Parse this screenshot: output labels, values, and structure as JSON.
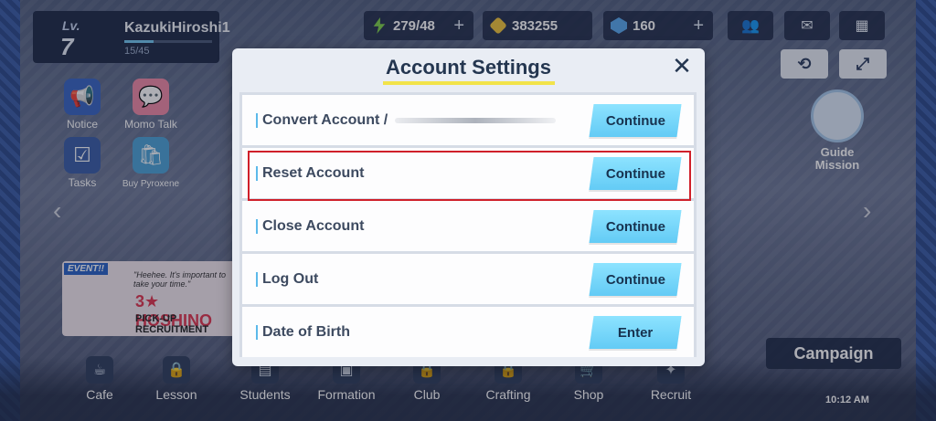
{
  "player": {
    "level_label": "Lv.",
    "level": "7",
    "name": "KazukiHiroshi1",
    "exp": "15/45",
    "exp_fraction": 0.33
  },
  "resources": {
    "ap": {
      "value": "279/48",
      "icon": "ap-bolt-icon",
      "color": "#7fd14a"
    },
    "credits": {
      "value": "383255",
      "icon": "credit-icon",
      "color": "#f2c53b"
    },
    "pyroxene": {
      "value": "160",
      "icon": "pyroxene-icon",
      "color": "#5aa9ef"
    },
    "plus": "+"
  },
  "side_icons": [
    {
      "label": "Notice",
      "icon": "megaphone-icon"
    },
    {
      "label": "Momo Talk",
      "icon": "chat-icon"
    },
    {
      "label": "Tasks",
      "icon": "checklist-icon"
    },
    {
      "label": "Buy Pyroxene",
      "icon": "shop-bag-icon"
    }
  ],
  "event_banner": {
    "tag": "EVENT!!",
    "note": "\"Heehee. It's important to take your time.\"",
    "title": "3★ HOSHINO",
    "subtitle": "PICK-UP RECRUITMENT"
  },
  "guide_mission": {
    "line1": "Guide",
    "line2": "Mission"
  },
  "campaign": "Campaign",
  "bottom_nav": [
    "Cafe",
    "Lesson",
    "Students",
    "Formation",
    "Club",
    "Crafting",
    "Shop",
    "Recruit"
  ],
  "clock": "10:12 AM",
  "modal": {
    "title": "Account Settings",
    "close_glyph": "✕",
    "rows": [
      {
        "label": "Convert Account /",
        "button": "Continue"
      },
      {
        "label": "Reset Account",
        "button": "Continue"
      },
      {
        "label": "Close Account",
        "button": "Continue"
      },
      {
        "label": "Log Out",
        "button": "Continue"
      },
      {
        "label": "Date of Birth",
        "button": "Enter"
      }
    ]
  },
  "colors": {
    "accent_button": "#63cbf5",
    "title_underline": "#f2e34a",
    "highlight_border": "#d0202a"
  }
}
